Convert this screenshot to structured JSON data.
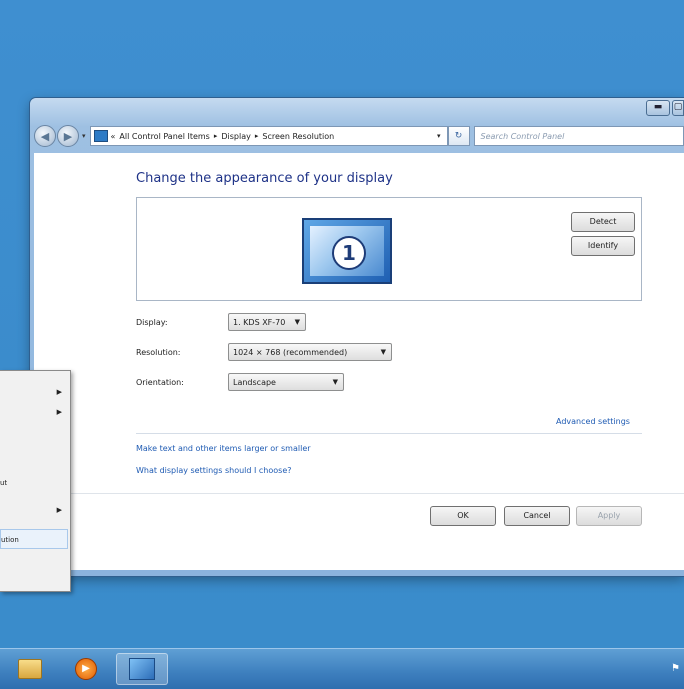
{
  "window": {
    "address": {
      "prefix": "«",
      "crumbs": [
        "All Control Panel Items",
        "Display",
        "Screen Resolution"
      ],
      "separator": "▸"
    },
    "search_placeholder": "Search Control Panel",
    "heading": "Change the appearance of your display",
    "monitor_number": "1",
    "detect_label": "Detect",
    "identify_label": "Identify",
    "display": {
      "label": "Display:",
      "value": "1. KDS XF-70"
    },
    "resolution": {
      "label": "Resolution:",
      "value": "1024 × 768 (recommended)"
    },
    "orientation": {
      "label": "Orientation:",
      "value": "Landscape"
    },
    "advanced_link": "Advanced settings",
    "link_text_size": "Make text and other items larger or smaller",
    "link_help": "What display settings should I choose?",
    "ok_label": "OK",
    "cancel_label": "Cancel",
    "apply_label": "Apply"
  },
  "context_menu": {
    "items": [
      {
        "text": "",
        "has_arrow": true
      },
      {
        "text": "",
        "has_arrow": true
      },
      {
        "text": "ut",
        "has_arrow": false
      },
      {
        "text": "",
        "has_arrow": true
      },
      {
        "text": "ution",
        "has_arrow": false,
        "highlighted": true
      }
    ]
  },
  "taskbar": {
    "items": [
      "file-explorer-icon",
      "media-player-icon",
      "control-panel-icon"
    ],
    "active": "control-panel-icon"
  },
  "colors": {
    "desktop": "#3b8ccc",
    "heading": "#1e3287",
    "link": "#1f5bb3"
  }
}
